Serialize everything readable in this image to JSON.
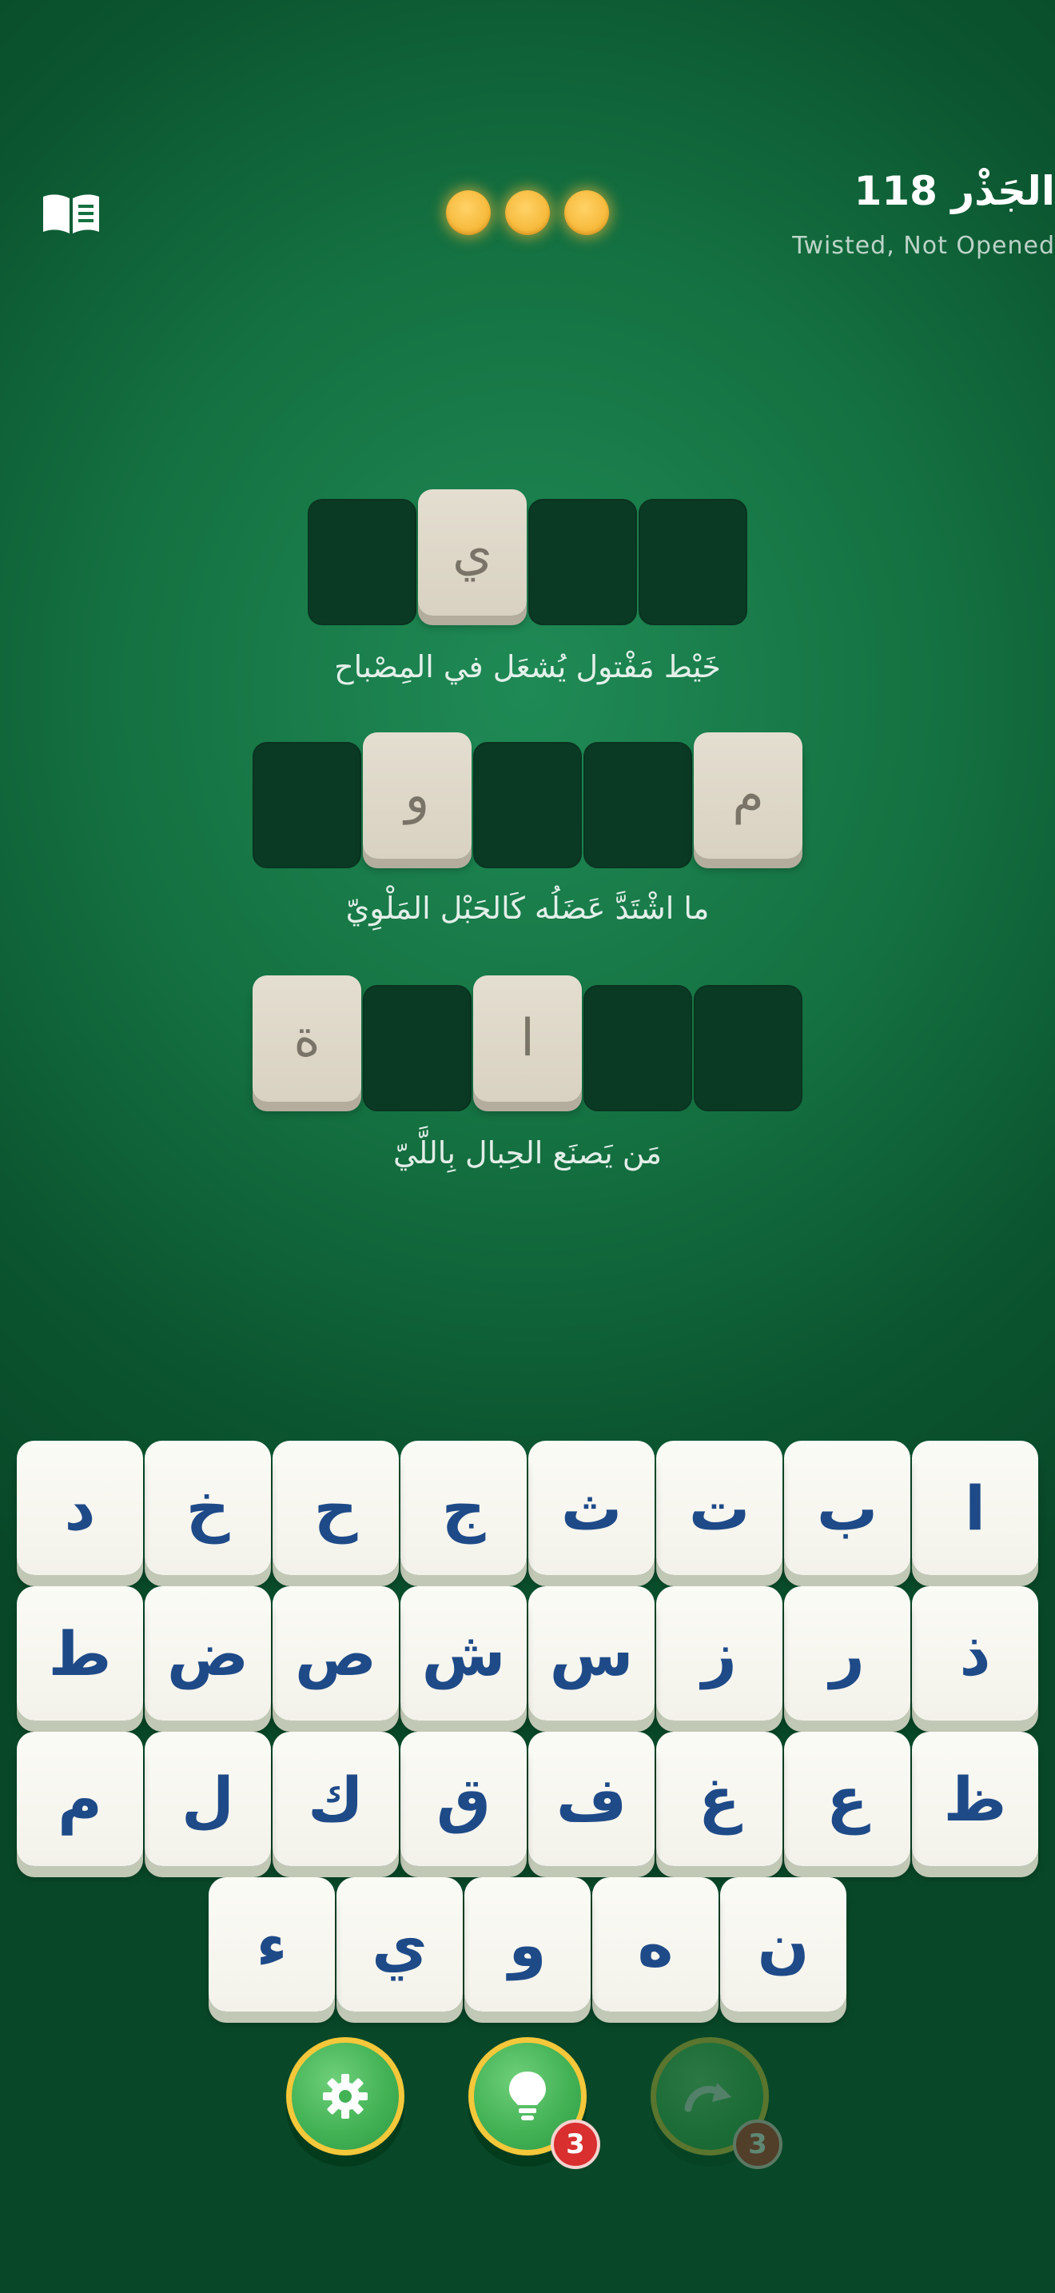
{
  "header": {
    "title": "الجَذْر 118",
    "subtitle": "Twisted, Not Opened",
    "progress_dots": 3
  },
  "words": [
    {
      "slots": [
        "",
        "ي",
        "",
        ""
      ],
      "clue": "خَيْط مَفْتول يُشعَل في المِصْباح"
    },
    {
      "slots": [
        "",
        "و",
        "",
        "",
        "م"
      ],
      "clue": "ما اشْتَدَّ عَضَلُه كَالحَبْل المَلْوِيّ"
    },
    {
      "slots": [
        "ة",
        "",
        "ا",
        "",
        ""
      ],
      "clue": "مَن يَصنَع الحِبال بِاللَّيّ"
    }
  ],
  "keyboard": {
    "row1": [
      "ا",
      "ب",
      "ت",
      "ث",
      "ج",
      "ح",
      "خ",
      "د"
    ],
    "row2": [
      "ذ",
      "ر",
      "ز",
      "س",
      "ش",
      "ص",
      "ض",
      "ط"
    ],
    "row3": [
      "ظ",
      "ع",
      "غ",
      "ف",
      "ق",
      "ك",
      "ل",
      "م"
    ],
    "row4": [
      "ن",
      "ه",
      "و",
      "ي",
      "ء"
    ]
  },
  "controls": {
    "settings_icon": "gear-icon",
    "hint_icon": "lightbulb-icon",
    "hint_count": "3",
    "skip_icon": "redo-arrow-icon",
    "skip_count": "3"
  },
  "colors": {
    "background": "#147040",
    "tile_filled": "#e0dacb",
    "tile_empty": "#0b3a24",
    "key_text": "#1e4a88",
    "button_ring": "#f4c83a",
    "badge": "#d92f2f"
  }
}
